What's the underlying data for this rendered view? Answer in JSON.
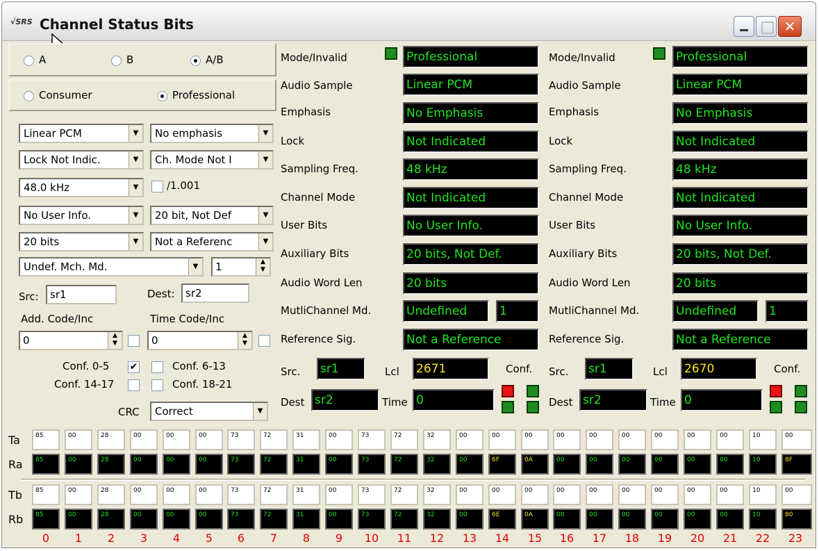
{
  "window": {
    "title": "Channel Status Bits",
    "app_logo": "√SRS"
  },
  "left": {
    "channel_radios": [
      {
        "label": "A",
        "checked": false
      },
      {
        "label": "B",
        "checked": false
      },
      {
        "label": "A/B",
        "checked": true
      }
    ],
    "mode_radios": [
      {
        "label": "Consumer",
        "checked": false
      },
      {
        "label": "Professional",
        "checked": true
      }
    ],
    "combos": {
      "audio_sample": "Linear PCM",
      "emphasis": "No emphasis",
      "lock": "Lock Not Indic.",
      "channel_mode": "Ch. Mode Not I",
      "sampling": "48.0 kHz",
      "user_info": "No User Info.",
      "aux_bits": "20 bit, Not Def",
      "word_len": "20 bits",
      "reference": "Not a Referenc",
      "multichannel": "Undef. Mch. Md.",
      "crc": "Correct"
    },
    "rate_1001_label": "/1.001",
    "mch_spin": "1",
    "src_label": "Src:",
    "src_value": "sr1",
    "dest_label": "Dest:",
    "dest_value": "sr2",
    "add_code_label": "Add. Code/Inc",
    "add_code_value": "0",
    "time_code_label": "Time Code/Inc",
    "time_code_value": "0",
    "conf_0_5": "Conf. 0-5",
    "conf_6_13": "Conf. 6-13",
    "conf_14_17": "Conf. 14-17",
    "conf_18_21": "Conf. 18-21",
    "crc_label": "CRC"
  },
  "status_labels": [
    "Mode/Invalid",
    "Audio Sample",
    "Emphasis",
    "Lock",
    "Sampling Freq.",
    "Channel Mode",
    "User Bits",
    "Auxiliary Bits",
    "Audio Word Len",
    "MutliChannel Md.",
    "Reference Sig."
  ],
  "status_a": {
    "values": [
      "Professional",
      "Linear PCM",
      "No Emphasis",
      "Not Indicated",
      "48 kHz",
      "Not Indicated",
      "No User Info.",
      "20 bits, Not Def.",
      "20 bits",
      "Undefined",
      "Not a Reference"
    ],
    "mch_num": "1",
    "src_label": "Src.",
    "src": "sr1",
    "lcl_label": "Lcl",
    "lcl": "2671",
    "conf_label": "Conf.",
    "dest_label": "Dest",
    "dest": "sr2",
    "time_label": "Time",
    "time": "0"
  },
  "status_b": {
    "values": [
      "Professional",
      "Linear PCM",
      "No Emphasis",
      "Not Indicated",
      "48 kHz",
      "Not Indicated",
      "No User Info.",
      "20 bits, Not Def.",
      "20 bits",
      "Undefined",
      "Not a Reference"
    ],
    "mch_num": "1",
    "src_label": "Src.",
    "src": "sr1",
    "lcl_label": "Lcl",
    "lcl": "2670",
    "conf_label": "Conf.",
    "dest_label": "Dest",
    "dest": "sr2",
    "time_label": "Time",
    "time": "0"
  },
  "bytes": {
    "row_labels": [
      "Ta",
      "Ra",
      "Tb",
      "Rb"
    ],
    "Ta": [
      "85",
      "00",
      "28",
      "00",
      "00",
      "00",
      "73",
      "72",
      "31",
      "00",
      "73",
      "72",
      "32",
      "00",
      "00",
      "00",
      "00",
      "00",
      "00",
      "00",
      "00",
      "00",
      "10",
      "00"
    ],
    "Ra": [
      "85",
      "00",
      "28",
      "00",
      "00",
      "00",
      "73",
      "72",
      "31",
      "00",
      "73",
      "72",
      "32",
      "00",
      "6F",
      "0A",
      "00",
      "00",
      "00",
      "00",
      "00",
      "00",
      "10",
      "8F"
    ],
    "Tb": [
      "85",
      "00",
      "28",
      "00",
      "00",
      "00",
      "73",
      "72",
      "31",
      "00",
      "73",
      "72",
      "32",
      "00",
      "00",
      "00",
      "00",
      "00",
      "00",
      "00",
      "00",
      "00",
      "10",
      "00"
    ],
    "Rb": [
      "85",
      "00",
      "28",
      "00",
      "00",
      "00",
      "73",
      "72",
      "31",
      "00",
      "73",
      "72",
      "32",
      "00",
      "6E",
      "0A",
      "00",
      "00",
      "00",
      "00",
      "00",
      "00",
      "10",
      "80"
    ],
    "indices": [
      "0",
      "1",
      "2",
      "3",
      "4",
      "5",
      "6",
      "7",
      "8",
      "9",
      "10",
      "11",
      "12",
      "13",
      "14",
      "15",
      "16",
      "17",
      "18",
      "19",
      "20",
      "21",
      "22",
      "23"
    ]
  }
}
